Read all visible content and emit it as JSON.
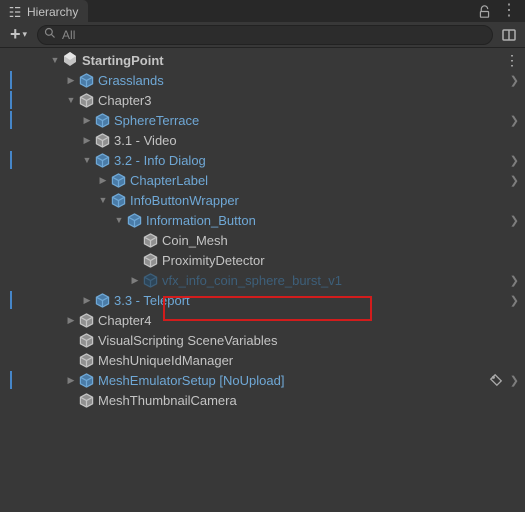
{
  "panel_title": "Hierarchy",
  "search": {
    "placeholder": "All"
  },
  "tree": {
    "root": {
      "label": "StartingPoint"
    },
    "rows": [
      {
        "label": "Grasslands"
      },
      {
        "label": "Chapter3"
      },
      {
        "label": "SphereTerrace"
      },
      {
        "label": "3.1 - Video"
      },
      {
        "label": "3.2 - Info Dialog"
      },
      {
        "label": "ChapterLabel"
      },
      {
        "label": "InfoButtonWrapper"
      },
      {
        "label": "Information_Button"
      },
      {
        "label": "Coin_Mesh"
      },
      {
        "label": "ProximityDetector"
      },
      {
        "label": "vfx_info_coin_sphere_burst_v1"
      },
      {
        "label": "3.3 - Teleport"
      },
      {
        "label": "Chapter4"
      },
      {
        "label": "VisualScripting SceneVariables"
      },
      {
        "label": "MeshUniqueIdManager"
      },
      {
        "label": "MeshEmulatorSetup [NoUpload]"
      },
      {
        "label": "MeshThumbnailCamera"
      }
    ]
  },
  "colors": {
    "prefab": "#6fa8d6",
    "plain": "#c4c4c4",
    "highlight": "#d21c1c",
    "bluebar": "#4686c8"
  }
}
